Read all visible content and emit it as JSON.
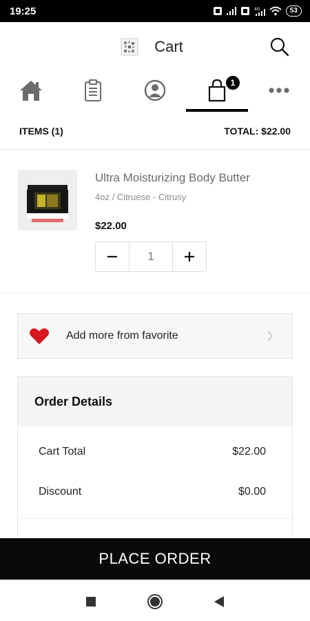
{
  "status_bar": {
    "time": "19:25",
    "battery": "53",
    "icons": [
      "sim-icon",
      "signal-icon",
      "sim-icon",
      "signal-4g-icon",
      "wifi-icon",
      "battery-icon"
    ]
  },
  "header": {
    "title": "Cart",
    "logo_icon": "store-logo-icon",
    "search_icon": "search-icon"
  },
  "tabs": [
    {
      "name": "home",
      "icon": "home-icon"
    },
    {
      "name": "orders",
      "icon": "clipboard-icon"
    },
    {
      "name": "account",
      "icon": "user-icon"
    },
    {
      "name": "cart",
      "icon": "shopping-bag-icon",
      "active": true,
      "badge": "1"
    },
    {
      "name": "more",
      "icon": "more-icon"
    }
  ],
  "summary": {
    "items_label": "ITEMS (1)",
    "total_label": "TOTAL: $22.00"
  },
  "cart_item": {
    "name": "Ultra Moisturizing Body Butter",
    "variant": "4oz / Citruese - Citrusy",
    "price": "$22.00",
    "quantity": "1",
    "decrease_icon": "minus-icon",
    "increase_icon": "plus-icon"
  },
  "favorite": {
    "label": "Add more from favorite",
    "icon": "heart-icon",
    "chevron": "chevron-right-icon"
  },
  "order_details": {
    "title": "Order Details",
    "lines": [
      {
        "label": "Cart Total",
        "value": "$22.00"
      },
      {
        "label": "Discount",
        "value": "$0.00"
      }
    ]
  },
  "place_order": {
    "label": "PLACE ORDER"
  },
  "nav_bar": {
    "icons": [
      "recents-square-icon",
      "home-circle-icon",
      "back-triangle-icon"
    ]
  },
  "colors": {
    "accent": "#000000",
    "heart": "#d7191f",
    "muted_text": "#6b6b6b",
    "panel_bg": "#f4f5f5"
  }
}
